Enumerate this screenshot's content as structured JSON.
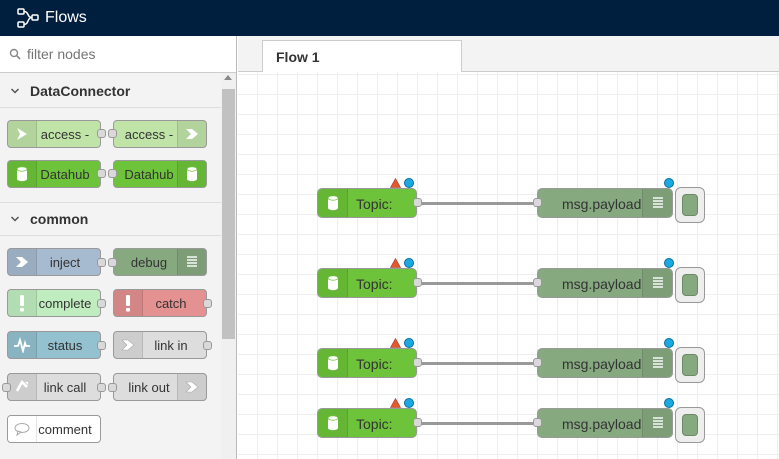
{
  "header": {
    "title": "Flows"
  },
  "palette": {
    "filter_placeholder": "filter nodes",
    "categories": [
      {
        "label": "DataConnector"
      },
      {
        "label": "common"
      }
    ],
    "nodes": {
      "access_in": "access -",
      "access_out": "access -",
      "datahub_in": "Datahub",
      "datahub_out": "Datahub",
      "inject": "inject",
      "debug": "debug",
      "complete": "complete",
      "catch": "catch",
      "status": "status",
      "link_in": "link in",
      "link_call": "link call",
      "link_out": "link out",
      "comment": "comment"
    }
  },
  "workspace": {
    "tab": "Flow 1",
    "flow_nodes": [
      {
        "input": "Topic:",
        "output": "msg.payload"
      },
      {
        "input": "Topic:",
        "output": "msg.payload"
      },
      {
        "input": "Topic:",
        "output": "msg.payload"
      },
      {
        "input": "Topic:",
        "output": "msg.payload"
      }
    ]
  },
  "colors": {
    "header_bg": "#001f3f",
    "dataconnector_green": "#6dc43a",
    "access_green": "#c0e4a8",
    "inject_blue": "#a6bbcf",
    "debug_green": "#87a980",
    "complete_green": "#c0edc0",
    "catch_red": "#e49191",
    "status_blue": "#94c1d0",
    "link_grey": "#dddddd",
    "status_dot": "#1ba9e0"
  }
}
